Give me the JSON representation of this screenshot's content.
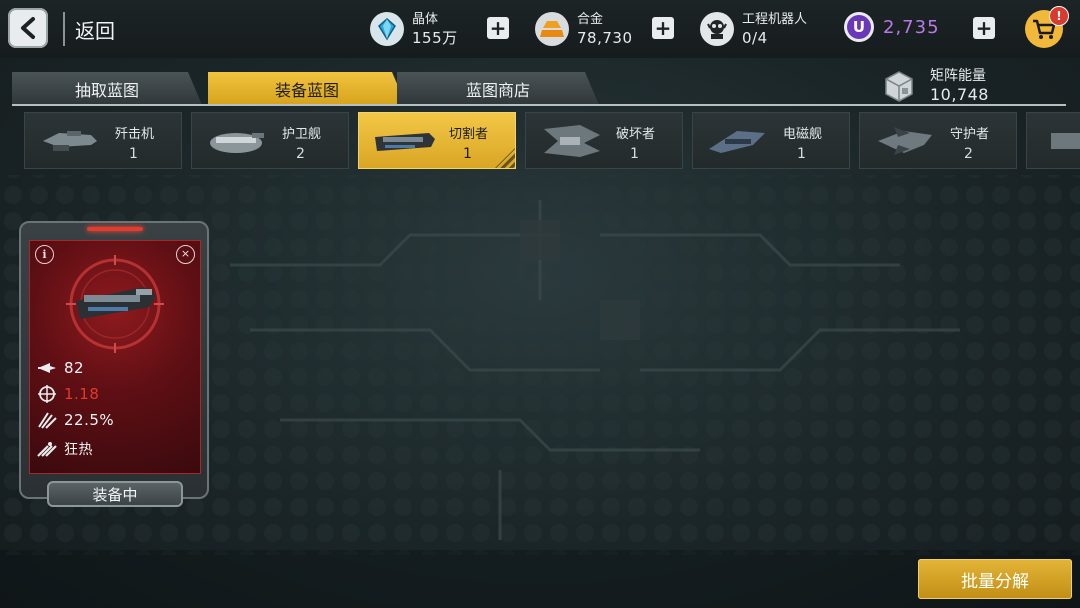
{
  "header": {
    "back_label": "返回",
    "resources": [
      {
        "name": "晶体",
        "value": "155万",
        "icon": "crystal-icon"
      },
      {
        "name": "合金",
        "value": "78,730",
        "icon": "alloy-icon"
      },
      {
        "name": "工程机器人",
        "value": "0/4",
        "icon": "robot-icon"
      }
    ],
    "u_currency": {
      "value": "2,735",
      "icon_letter": "U",
      "color": "#b67be6"
    },
    "cart": {
      "icon": "cart-icon",
      "badge": "!"
    }
  },
  "tabs": [
    {
      "label": "抽取蓝图",
      "active": false
    },
    {
      "label": "装备蓝图",
      "active": true
    },
    {
      "label": "蓝图商店",
      "active": false
    }
  ],
  "matrix_energy": {
    "name": "矩阵能量",
    "value": "10,748"
  },
  "categories": [
    {
      "name": "歼击机",
      "count": "1",
      "active": false
    },
    {
      "name": "护卫舰",
      "count": "2",
      "active": false
    },
    {
      "name": "切割者",
      "count": "1",
      "active": true
    },
    {
      "name": "破坏者",
      "count": "1",
      "active": false
    },
    {
      "name": "电磁舰",
      "count": "1",
      "active": false
    },
    {
      "name": "守护者",
      "count": "2",
      "active": false
    }
  ],
  "card": {
    "info_icon": "i",
    "close_icon": "×",
    "stats": [
      {
        "icon": "arrow-icon",
        "value": "82"
      },
      {
        "icon": "crosshair-icon",
        "value": "1.18"
      },
      {
        "icon": "claw-icon",
        "value": "22.5%"
      },
      {
        "icon": "missiles-icon",
        "value": "狂热"
      }
    ],
    "equip_label": "装备中"
  },
  "batch_button": "批量分解",
  "colors": {
    "accent": "#e3b538",
    "card_red": "#5e0f14",
    "stat_red": "#e2382e",
    "u_purple": "#6a37b8"
  }
}
